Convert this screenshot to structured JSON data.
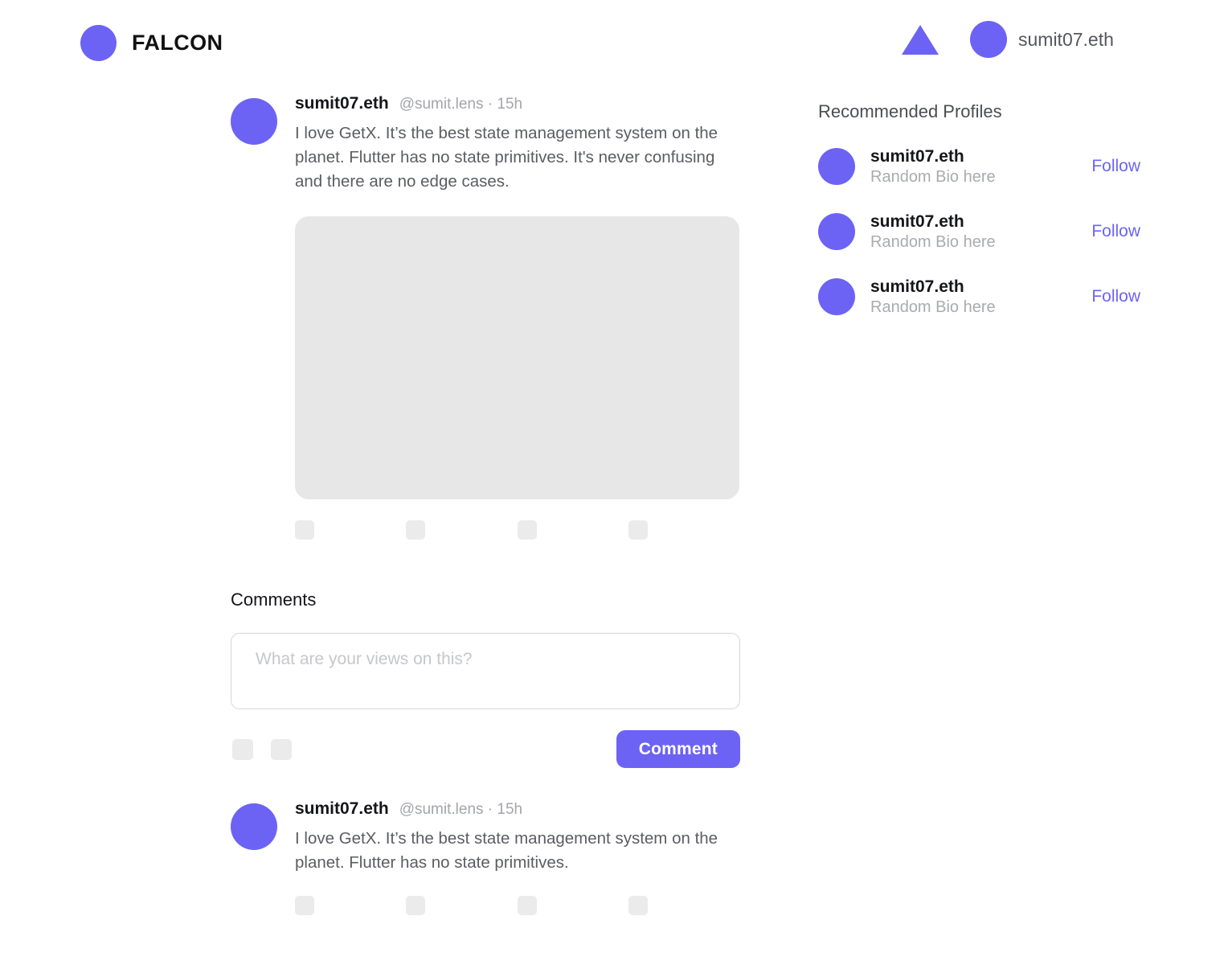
{
  "header": {
    "brand_name": "FALCON",
    "logo_icon": "falcon-logo-circle",
    "triangle_icon": "triangle-up-icon",
    "username": "sumit07.eth"
  },
  "colors": {
    "accent": "#6C63F5",
    "placeholder_gray": "#e7e7e7",
    "icon_placeholder_gray": "#ebebeb",
    "muted_text": "#a3a5aa",
    "body_text": "#5b5d63"
  },
  "post": {
    "author": "sumit07.eth",
    "handle": "@sumit.lens · 15h",
    "text": "I love GetX. It’s the best state management system on the planet. Flutter has no state primitives. It's never confusing and there are no edge cases.",
    "media_placeholder": "post-image-placeholder",
    "actions": [
      {
        "name": "like-icon-placeholder"
      },
      {
        "name": "comment-icon-placeholder"
      },
      {
        "name": "mirror-icon-placeholder"
      },
      {
        "name": "collect-icon-placeholder"
      }
    ]
  },
  "comments": {
    "title": "Comments",
    "input_placeholder": "What are your views on this?",
    "input_value": "",
    "toolbar_icons": [
      {
        "name": "image-upload-icon-placeholder"
      },
      {
        "name": "emoji-icon-placeholder"
      }
    ],
    "submit_label": "Comment"
  },
  "reply": {
    "author": "sumit07.eth",
    "handle": "@sumit.lens · 15h",
    "text": "I love GetX. It’s the best state management system on the planet. Flutter has no state primitives.",
    "actions": [
      {
        "name": "like-icon-placeholder"
      },
      {
        "name": "comment-icon-placeholder"
      },
      {
        "name": "mirror-icon-placeholder"
      },
      {
        "name": "collect-icon-placeholder"
      }
    ]
  },
  "sidebar": {
    "title": "Recommended Profiles",
    "profiles": [
      {
        "name": "sumit07.eth",
        "bio": "Random Bio here",
        "follow_label": "Follow"
      },
      {
        "name": "sumit07.eth",
        "bio": "Random Bio here",
        "follow_label": "Follow"
      },
      {
        "name": "sumit07.eth",
        "bio": "Random Bio here",
        "follow_label": "Follow"
      }
    ]
  }
}
